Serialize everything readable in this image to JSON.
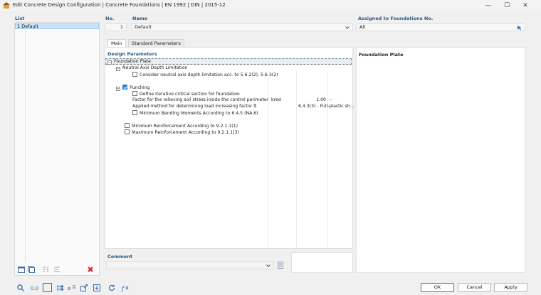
{
  "window": {
    "title": "Edit Concrete Design Configuration | Concrete Foundations | EN 1992 | DIN | 2015-12",
    "min_glyph": "—",
    "max_glyph": "☐",
    "close_glyph": "✕"
  },
  "list": {
    "header": "List",
    "items": [
      {
        "label": "1  Default"
      }
    ]
  },
  "config": {
    "no_label": "No.",
    "no_value": "1",
    "name_label": "Name",
    "name_value": "Default",
    "assigned_label": "Assigned to Foundations No.",
    "assigned_value": "All"
  },
  "tabs": [
    {
      "label": "Main",
      "active": true
    },
    {
      "label": "Standard Parameters",
      "active": false
    }
  ],
  "design_params": {
    "header": "Design Parameters",
    "foundation_plate": "Foundation Plate",
    "neutral_axis": "Neutral Axis Depth Limitation",
    "neutral_axis_option": "Consider neutral axis depth limitation acc. to 5.6.2(2), 5.6.3(2)",
    "punching": "Punching",
    "define_iterative": "Define iterative critical section for foundation",
    "factor_label": "Factor for the relieving soil stress inside the control perimeter",
    "factor_symbol": "kred",
    "factor_value": "1.00",
    "factor_unit": "--",
    "applied_method_label": "Applied method for determining load increasing factor ß",
    "applied_method_value": "6.4.3(3) - Full-plastic sh...",
    "min_bending": "Minimum Bending Moments According to 6.4.5 (NA.6)",
    "min_reinf": "Minimum Reinforcement According to 9.2.1.1(1)",
    "max_reinf": "Maximum Reinforcement According to 9.2.1.1(3)"
  },
  "right_panel": {
    "header": "Foundation Plate"
  },
  "comment": {
    "header": "Comment"
  },
  "buttons": {
    "ok": "OK",
    "cancel": "Cancel",
    "apply": "Apply"
  },
  "colors": {
    "accent": "#2a7fd4",
    "header_text": "#2b5a8a",
    "delete": "#d42020"
  }
}
